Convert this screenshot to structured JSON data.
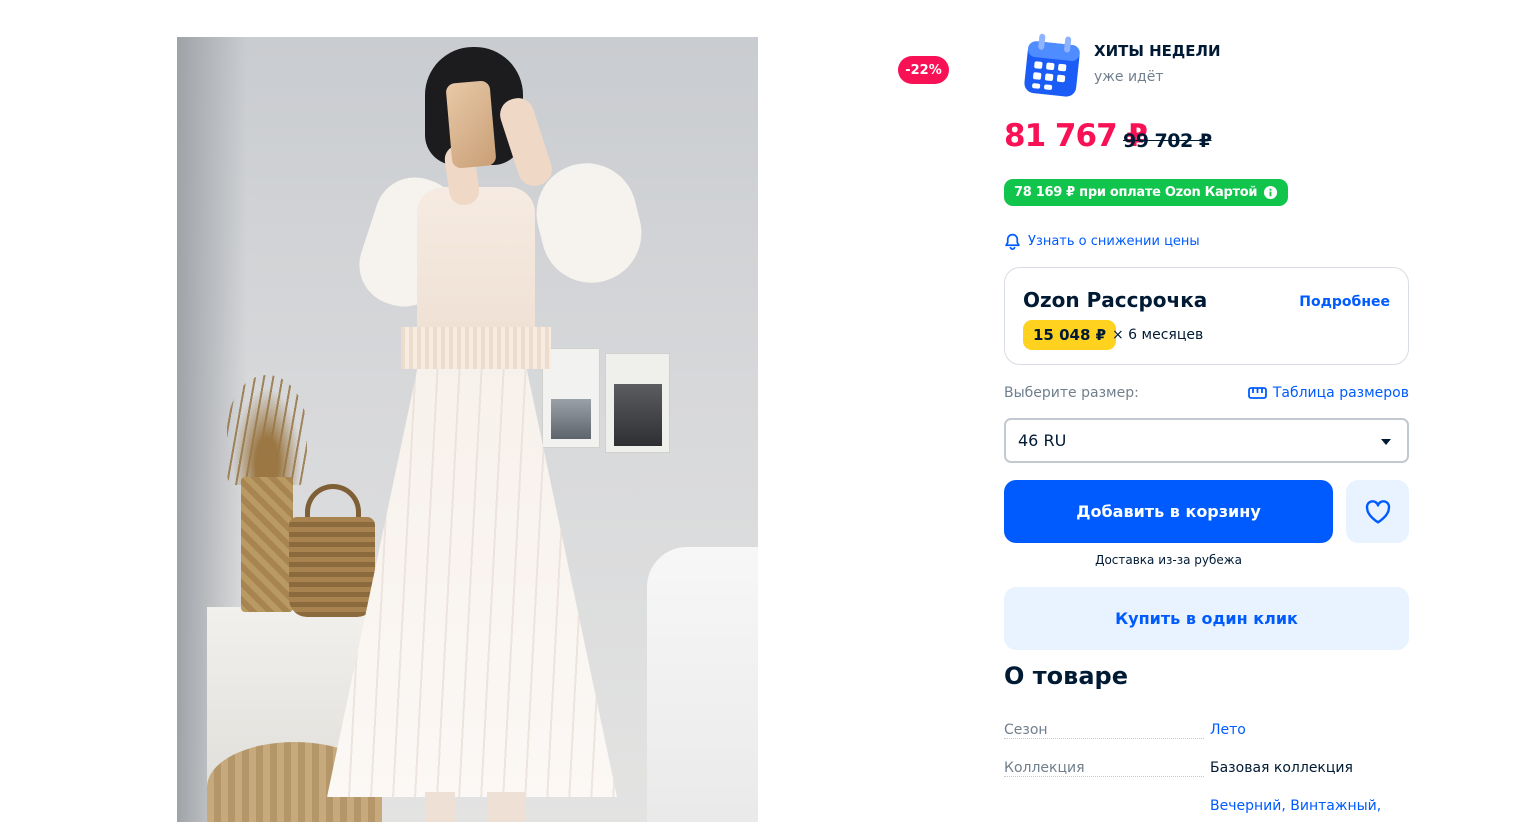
{
  "discount_badge": "-22%",
  "promo": {
    "title": "ХИТЫ НЕДЕЛИ",
    "subtitle": "уже идёт",
    "icon": "calendar-icon"
  },
  "price": {
    "current": "81 767 ₽",
    "old": "99 702 ₽",
    "card_offer": "78 169 ₽ при оплате Ozon Картой"
  },
  "notify_link": "Узнать о снижении цены",
  "installment": {
    "title": "Ozon Рассрочка",
    "more_link": "Подробнее",
    "monthly_amount": "15 048 ₽",
    "months": "× 6 месяцев"
  },
  "size": {
    "label": "Выберите размер:",
    "table_link": "Таблица размеров",
    "selected": "46 RU"
  },
  "buttons": {
    "add_to_cart": "Добавить в корзину",
    "buy_one_click": "Купить в один клик"
  },
  "delivery_note": "Доставка из-за рубежа",
  "about": {
    "title": "О товаре",
    "specs": [
      {
        "name": "Сезон",
        "value": "Лето",
        "is_link": true
      },
      {
        "name": "Коллекция",
        "value": "Базовая коллекция",
        "is_link": false
      },
      {
        "name": "",
        "value": "Вечерний, Винтажный,",
        "is_link": true
      }
    ]
  },
  "colors": {
    "accent_blue": "#005bff",
    "price_red": "#f91155",
    "card_green": "#10c44c",
    "installment_yellow": "#ffd21f"
  }
}
